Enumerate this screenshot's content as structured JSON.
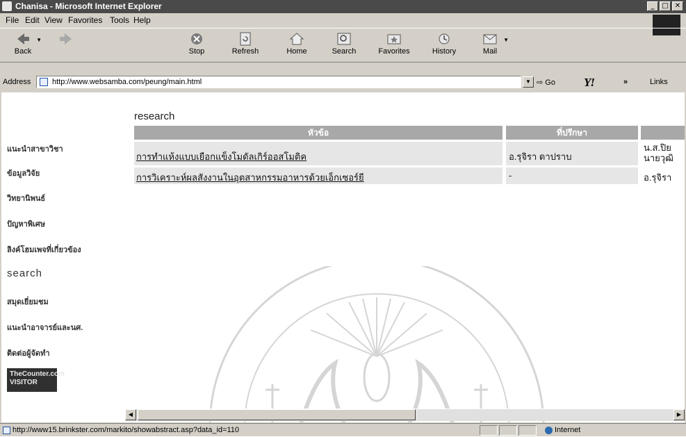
{
  "window": {
    "title": "Chanisa - Microsoft Internet Explorer"
  },
  "menu": [
    "File",
    "Edit",
    "View",
    "Favorites",
    "Tools",
    "Help"
  ],
  "toolbar": {
    "back": "Back",
    "forward": "",
    "stop": "Stop",
    "refresh": "Refresh",
    "home": "Home",
    "search": "Search",
    "favorites": "Favorites",
    "history": "History",
    "mail": "Mail"
  },
  "address": {
    "label": "Address",
    "url": "http://www.websamba.com/peung/main.html",
    "go": "Go",
    "chevron": "»",
    "links": "Links"
  },
  "sidebar": {
    "items": [
      "แนะนำสาขาวิชา",
      "ข้อมูลวิจัย",
      "วิทยานิพนธ์",
      "ปัญหาพิเศษ",
      "ลิงค์โฮมเพจที่เกี่ยวข้อง",
      "search",
      "สมุดเยี่ยมชม",
      "แนะนำอาจารย์และนศ.",
      "ติดต่อผู้จัดทำ"
    ],
    "counter": "TheCounter.com\nVISITOR"
  },
  "main": {
    "heading": "research",
    "columns": [
      "หัวข้อ",
      "ที่ปรึกษา",
      ""
    ],
    "rows": [
      [
        "การทำแห้งแบบเยือกแข็งโมดัลเกิร์ออสโมติค",
        "อ.รุจิรา ดาปราบ",
        "น.ส.ปิย\nนายวุฒิ"
      ],
      [
        "การวิเคราะห์ผลสังงานในอุตสาหกรรมอาหารด้วยเอ็กเซอร์ยี",
        "-",
        "อ.รุจิรา"
      ]
    ]
  },
  "status": {
    "url": "http://www15.brinkster.com/markito/showabstract.asp?data_id=110",
    "zone": "Internet"
  }
}
